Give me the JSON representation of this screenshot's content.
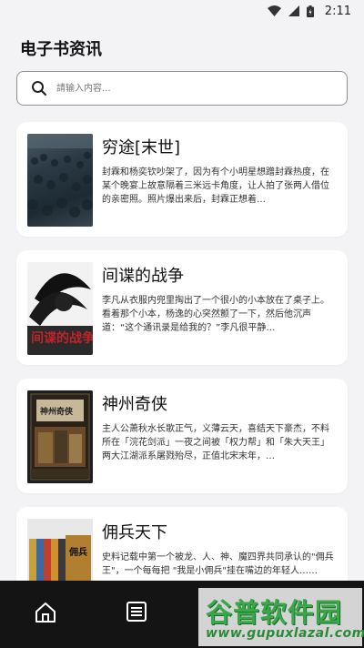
{
  "status_bar": {
    "time": "2:11",
    "icons": [
      "wifi-icon",
      "signal-icon",
      "battery-icon"
    ]
  },
  "header": {
    "title": "电子书资讯"
  },
  "search": {
    "placeholder": "請输入内容..."
  },
  "books": [
    {
      "title": "穷途[末世]",
      "description": "封霖和杨奕钦吵架了，因为有个小明星想蹭封霖热度，在某个晚宴上故意隔着三米远卡角度，让人拍了张两人借位的亲密照。照片爆出来后，封霖正想着…"
    },
    {
      "title": "间谍的战争",
      "description": "李凡从衣服内兜里掏出了一个很小的小本放在了桌子上。看着那个小本，杨逸的心突然颤了一下，然后他沉声道：“这个通讯录是给我的？”李凡很平静…"
    },
    {
      "title": "神州奇侠",
      "description": "主人公萧秋水长歌正气，义薄云天，喜结天下豪杰，不料所在「浣花剑派」一夜之间被「权力帮」和「朱大天王」两大江湖派系屠戮殆尽，正值北宋末年，…"
    },
    {
      "title": "佣兵天下",
      "description": "史料记载中第一个被龙、人、神、魔四界共同承认的\"佣兵王\"，一个每每把 \"我是小佣兵\"挂在嘴边的年轻人……"
    }
  ],
  "nav": {
    "items": [
      "home-icon",
      "list-icon"
    ]
  },
  "watermark": {
    "title": "谷普软件园",
    "url": "www.gupuxlazal.com"
  },
  "colors": {
    "background": "#f3f3f5",
    "card": "#ffffff",
    "nav_bg": "#141414",
    "watermark_green": "#3aa84a"
  }
}
